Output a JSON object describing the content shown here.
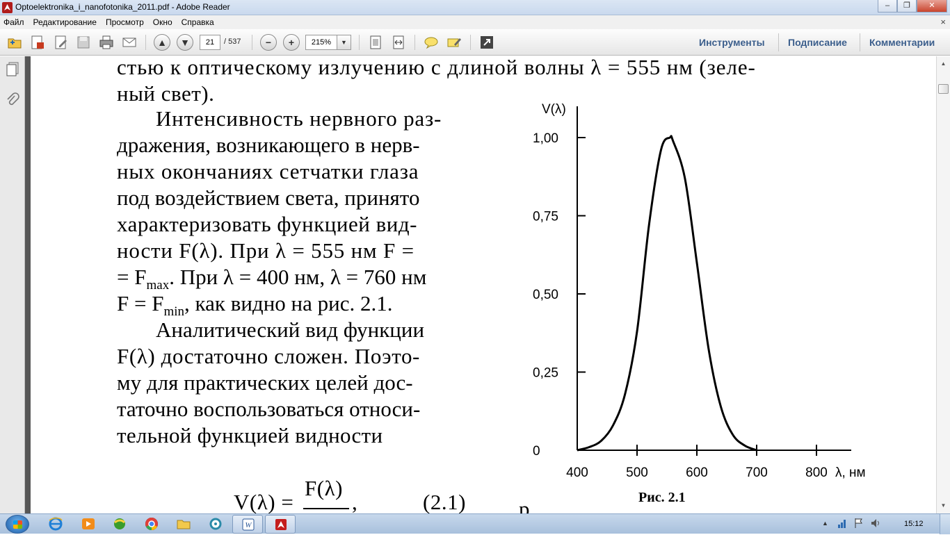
{
  "window": {
    "title": "Optoelektronika_i_nanofotonika_2011.pdf - Adobe Reader",
    "minimize": "–",
    "maximize": "❐",
    "close": "✕"
  },
  "menu": {
    "items": [
      "Файл",
      "Редактирование",
      "Просмотр",
      "Окно",
      "Справка"
    ],
    "close_glyph": "×"
  },
  "toolbar": {
    "page_current": "21",
    "page_total": "/ 537",
    "zoom": "215%",
    "zoom_dropdown": "▼",
    "zoom_out": "−",
    "zoom_in": "+",
    "right_links": [
      "Инструменты",
      "Подписание",
      "Комментарии"
    ]
  },
  "document": {
    "lines": [
      "стью к оптическому излучению с длиной волны λ = 555 нм (зеле-",
      "ный свет).",
      "Интенсивность нервного раз-",
      "дражения, возникающего в нерв-",
      "ных окончаниях сетчатки глаза",
      "под воздействием света, принято",
      "характеризовать функцией вид-",
      "ности F(λ). При λ = 555 нм F =",
      "= F",
      "max",
      ". При λ = 400 нм, λ = 760 нм",
      "F = F",
      "min",
      ", как видно на рис. 2.1.",
      "Аналитический вид функции",
      "F(λ) достаточно сложен. Поэто-",
      "му для практических целей дос-",
      "таточно воспользоваться относи-",
      "тельной функцией видности"
    ],
    "formula": {
      "lhs": "V(λ) =",
      "numerator": "F(λ)",
      "tail": ",",
      "number": "(2.1)",
      "cut_letter": "р"
    },
    "figure_caption": "Рис. 2.1"
  },
  "chart_data": {
    "type": "line",
    "ylabel": "V(λ)",
    "xlabel": "λ, нм",
    "x_ticks": [
      "400",
      "500",
      "600",
      "700",
      "800"
    ],
    "y_ticks": [
      "0",
      "0,25",
      "0,50",
      "0,75",
      "1,00"
    ],
    "xlim": [
      400,
      800
    ],
    "ylim": [
      0,
      1.0
    ],
    "grid": false,
    "series": [
      {
        "x": [
          400,
          420,
          440,
          460,
          480,
          500,
          520,
          540,
          555,
          560,
          580,
          600,
          620,
          640,
          660,
          680,
          700
        ],
        "values": [
          0.0,
          0.01,
          0.03,
          0.08,
          0.18,
          0.38,
          0.72,
          0.96,
          1.0,
          0.99,
          0.87,
          0.6,
          0.32,
          0.14,
          0.05,
          0.015,
          0.0
        ]
      }
    ]
  },
  "taskbar": {
    "clock": "15:12"
  }
}
